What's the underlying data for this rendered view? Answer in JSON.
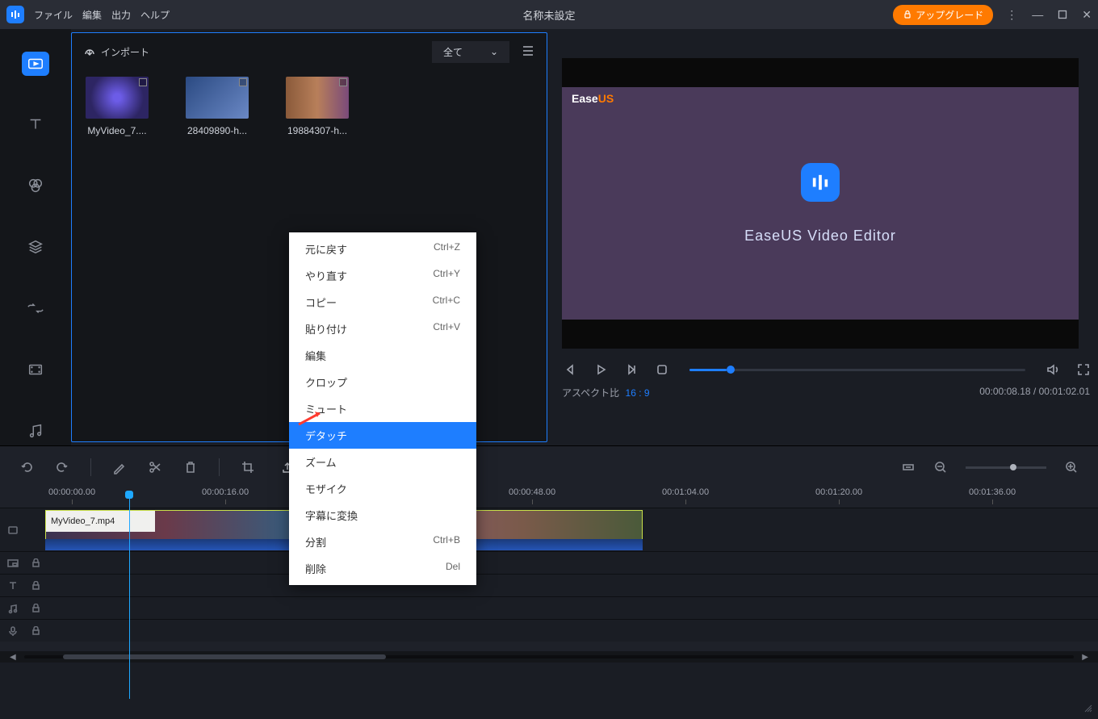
{
  "titlebar": {
    "menu": [
      "ファイル",
      "編集",
      "出力",
      "ヘルプ"
    ],
    "title": "名称未設定",
    "upgrade": "アップグレード"
  },
  "media": {
    "import_label": "インポート",
    "filter": "全て",
    "items": [
      {
        "name": "MyVideo_7...."
      },
      {
        "name": "28409890-h..."
      },
      {
        "name": "19884307-h..."
      }
    ]
  },
  "context_menu": {
    "items": [
      {
        "label": "元に戻す",
        "shortcut": "Ctrl+Z"
      },
      {
        "label": "やり直す",
        "shortcut": "Ctrl+Y"
      },
      {
        "label": "コピー",
        "shortcut": "Ctrl+C"
      },
      {
        "label": "貼り付け",
        "shortcut": "Ctrl+V"
      },
      {
        "label": "編集",
        "shortcut": ""
      },
      {
        "label": "クロップ",
        "shortcut": ""
      },
      {
        "label": "ミュート",
        "shortcut": ""
      },
      {
        "label": "デタッチ",
        "shortcut": "",
        "highlighted": true
      },
      {
        "label": "ズーム",
        "shortcut": ""
      },
      {
        "label": "モザイク",
        "shortcut": ""
      },
      {
        "label": "字幕に変換",
        "shortcut": ""
      },
      {
        "label": "分割",
        "shortcut": "Ctrl+B"
      },
      {
        "label": "削除",
        "shortcut": "Del"
      }
    ]
  },
  "preview": {
    "brand_ease": "Ease",
    "brand_us": "US",
    "product": "EaseUS  Video  Editor",
    "aspect_label": "アスペクト比",
    "aspect_value": "16 : 9",
    "timecode": "00:00:08.18 / 00:01:02.01"
  },
  "timeline": {
    "export_label": "出力",
    "ruler": [
      "00:00:00.00",
      "00:00:16.00",
      "00:00:48.00",
      "00:01:04.00",
      "00:01:20.00",
      "00:01:36.00"
    ],
    "clip_name": "MyVideo_7.mp4"
  }
}
